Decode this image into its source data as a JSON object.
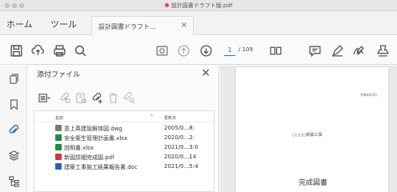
{
  "window": {
    "title": "設計図書ドラフト版.pdf"
  },
  "menu": {
    "home": "ホーム",
    "tools": "ツール"
  },
  "tab": {
    "label": "設計図書ドラフト…",
    "close": "×"
  },
  "toolbar": {
    "current_page": "1",
    "total_pages": "/ 109"
  },
  "panel": {
    "title": "添付ファイル",
    "close": "×",
    "columns": {
      "name": "名前",
      "sort": "^",
      "modified": "更新日"
    },
    "files": [
      {
        "name": "意上英建設解体図.dwg",
        "date": "2005/0...8:",
        "icon_color": "#7a7a7a"
      },
      {
        "name": "安全衛生管理計画書.xlsx",
        "date": "2020/0...2:",
        "icon_color": "#1f8a3e"
      },
      {
        "name": "説明書.xlsx",
        "date": "2021/0...3:0",
        "icon_color": "#1f8a3e"
      },
      {
        "name": "新図詳細完成図.pdf",
        "date": "2020/0...14",
        "icon_color": "#d6333b"
      },
      {
        "name": "建築工事施工結果報告書.doc",
        "date": "2021/0...5:4",
        "icon_color": "#2b5fb8"
      }
    ]
  },
  "document": {
    "date_text": "令和3年3月",
    "project": "○○○○新築工事",
    "title": "完成図書"
  },
  "colors": {
    "accent": "#2a6fd6",
    "pdf_red": "#e04848"
  }
}
